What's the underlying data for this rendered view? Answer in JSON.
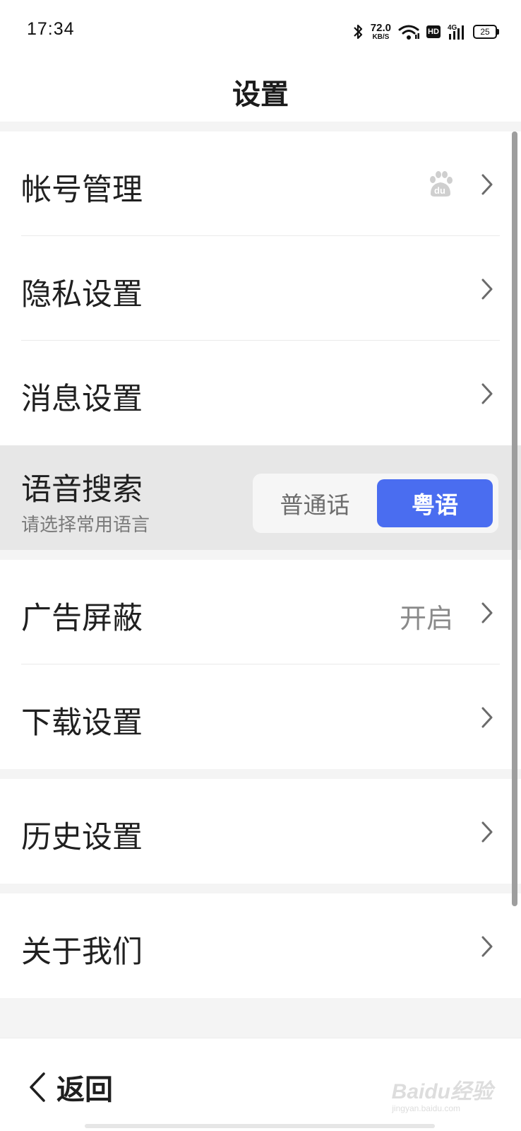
{
  "status_bar": {
    "time": "17:34",
    "net_speed_value": "72.0",
    "net_speed_unit": "KB/S",
    "hd_label": "HD",
    "network_type": "4G",
    "battery_level": "25",
    "icons": [
      "bluetooth-icon",
      "wifi-icon",
      "hd-icon",
      "cellular-signal-icon",
      "battery-icon"
    ]
  },
  "header": {
    "title": "设置"
  },
  "settings": {
    "account": {
      "label": "帐号管理",
      "badge_icon": "baidu-paw-icon"
    },
    "privacy": {
      "label": "隐私设置"
    },
    "message": {
      "label": "消息设置"
    },
    "voice_search": {
      "label": "语音搜索",
      "subtitle": "请选择常用语言",
      "options": [
        "普通话",
        "粤语"
      ],
      "selected": "粤语"
    },
    "ad_block": {
      "label": "广告屏蔽",
      "value": "开启"
    },
    "download": {
      "label": "下载设置"
    },
    "history": {
      "label": "历史设置"
    },
    "about": {
      "label": "关于我们"
    }
  },
  "footer": {
    "back_label": "返回",
    "watermark": "Baidu经验",
    "watermark_sub": "jingyan.baidu.com"
  },
  "colors": {
    "accent": "#4a6df0",
    "section_gap": "#f4f4f4",
    "highlight_row": "#e7e7e7",
    "secondary_text": "#8a8a8a"
  }
}
